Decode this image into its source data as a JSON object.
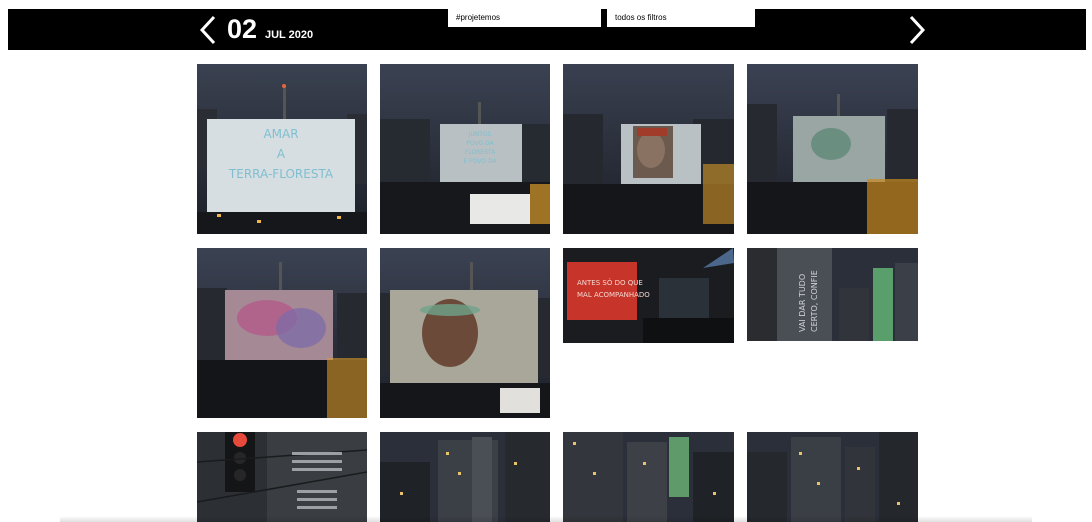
{
  "header": {
    "day": "02",
    "month_year": "JUL 2020",
    "prev_icon": "chevron-left-icon",
    "next_icon": "chevron-right-icon",
    "filters": [
      {
        "label": "#projetemos"
      },
      {
        "label": "todos os filtros"
      }
    ]
  },
  "photos": [
    {
      "caption_lines": [
        "AMAR",
        "A",
        "TERRA-FLORESTA"
      ]
    },
    {
      "caption_lines": [
        "JUNTOS",
        "POVO DA",
        "FLORESTA",
        "E POVO DA"
      ]
    },
    {
      "caption_lines": []
    },
    {
      "caption_lines": []
    },
    {
      "caption_lines": []
    },
    {
      "caption_lines": []
    },
    {
      "caption_lines": [
        "ANTES SÓ DO QUE",
        "MAL ACOMPANHADO"
      ]
    },
    {
      "caption_lines": [
        "VAI DAR TUDO",
        "CERTO, CONFIE"
      ]
    },
    {
      "caption_lines": []
    },
    {
      "caption_lines": []
    },
    {
      "caption_lines": []
    },
    {
      "caption_lines": []
    }
  ],
  "colors": {
    "bar": "#000000",
    "night_sky": "#2b2f3a",
    "projection": "#dfe6ea",
    "red_screen": "#c7352a"
  }
}
